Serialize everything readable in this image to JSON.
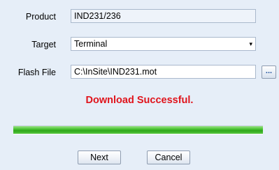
{
  "form": {
    "product_label": "Product",
    "product_value": "IND231/236",
    "target_label": "Target",
    "target_value": "Terminal",
    "flash_label": "Flash File",
    "flash_value": "C:\\InSite\\IND231.mot",
    "browse_label": "..."
  },
  "status": {
    "message": "Download Successful.",
    "color": "#e0141c"
  },
  "progress": {
    "percent": 100,
    "color": "#3cb424"
  },
  "buttons": {
    "next_label": "Next",
    "cancel_label": "Cancel"
  },
  "icons": {
    "select_arrow": "dropdown-arrow-icon"
  }
}
